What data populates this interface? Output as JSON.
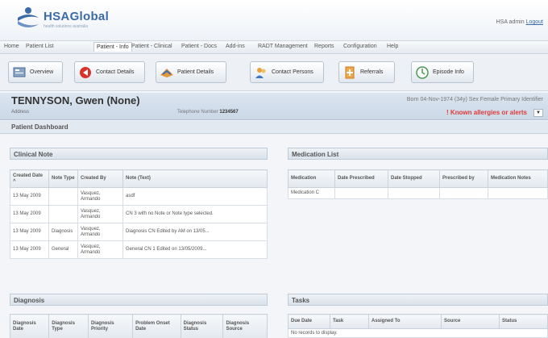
{
  "header": {
    "brand": "HSAGlobal",
    "tagline": "health solutions australia",
    "user": "HSA admin",
    "logout": "Logout"
  },
  "menu": [
    "Home",
    "Patient List",
    "Patient - Info",
    "Patient - Clinical",
    "Patient - Docs",
    "Add-ins",
    "RADT Management",
    "Reports",
    "Configuration",
    "Help"
  ],
  "toolbar": [
    "Overview",
    "Contact Details",
    "Patient Details",
    "Contact Persons",
    "Referrals",
    "Episode Info"
  ],
  "patient": {
    "name": "TENNYSON, Gwen (None)",
    "address_label": "Address",
    "telephone_label": "Telephone Number",
    "telephone": "1234567",
    "demographics": "Born 04-Nov-1974 (34y) Sex Female Primary Identifier",
    "allergy": "! Known allergies or alerts"
  },
  "dashboard_title": "Patient Dashboard",
  "clinical_note": {
    "title": "Clinical Note",
    "columns": [
      "Created Date",
      "Note Type",
      "Created By",
      "Note (Text)"
    ],
    "rows": [
      [
        "13 May 2009",
        "",
        "Vasquez, Armando",
        "asdf"
      ],
      [
        "13 May 2009",
        "",
        "Vasquez, Armando",
        "CN 3 with no Note or Note type selected."
      ],
      [
        "13 May 2009",
        "Diagnosis",
        "Vasquez, Armando",
        "Diagnosis CN Edited by AM on 13/05..."
      ],
      [
        "13 May 2009",
        "General",
        "Vasquez, Armando",
        "General CN 1 Edited on 13/05/2009..."
      ]
    ]
  },
  "medication": {
    "title": "Medication List",
    "columns": [
      "Medication",
      "Date Prescribed",
      "Date Stopped",
      "Prescribed by",
      "Medication Notes"
    ],
    "rows": [
      [
        "Medication C",
        "",
        "",
        "",
        ""
      ]
    ]
  },
  "diagnosis": {
    "title": "Diagnosis",
    "columns": [
      "Diagnosis Date",
      "Diagnosis Type",
      "Diagnosis Priority",
      "Problem Onset Date",
      "Diagnosis Status",
      "Diagnosis Source"
    ]
  },
  "tasks": {
    "title": "Tasks",
    "columns": [
      "Due Date",
      "Task",
      "Assigned To",
      "Source",
      "Status"
    ],
    "empty": "No records to display."
  },
  "colors": {
    "brand": "#3a6aa8",
    "alert": "#e23a3a"
  }
}
